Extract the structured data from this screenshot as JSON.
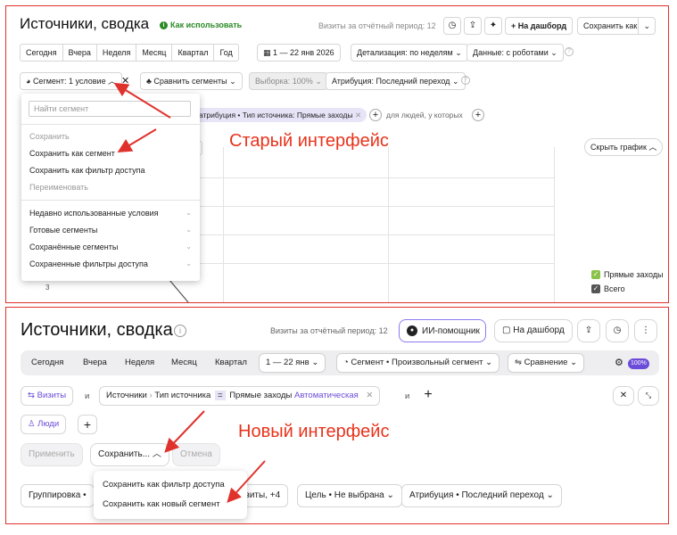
{
  "old_ui": {
    "title": "Источники, сводка",
    "help_link": "Как использовать",
    "visits": "Визиты за отчётный период: 12",
    "dashboard_button": "На дашборд",
    "save_as_button": "Сохранить как",
    "periods": [
      "Сегодня",
      "Вчера",
      "Неделя",
      "Месяц",
      "Квартал",
      "Год"
    ],
    "date_range": "1 — 22 янв 2026",
    "detail_select": "Детализация: по неделям",
    "data_select": "Данные: с роботами",
    "segment_button": "Сегмент: 1 условие",
    "compare_button": "Сравнить сегменты",
    "sample_button": "Выборка: 100%",
    "attribution_button": "Атрибуция: Последний переход",
    "chip_label": "атрибуция • Тип источника: Прямые заходы",
    "people_text": "для людей, у которых",
    "hide_chart_button": "Скрыть график",
    "dropdown": {
      "search_placeholder": "Найти сегмент",
      "save_label": "Сохранить",
      "save_as_segment": "Сохранить как сегмент",
      "save_as_filter": "Сохранить как фильтр доступа",
      "rename": "Переименовать",
      "groups": [
        "Недавно использованные условия",
        "Готовые сегменты",
        "Сохранённые сегменты",
        "Сохраненные фильтры доступа"
      ]
    },
    "y_tick": "3",
    "legend": [
      "Прямые заходы",
      "Всего"
    ],
    "annotation": "Старый интерфейс"
  },
  "new_ui": {
    "title": "Источники, сводка",
    "visits": "Визиты за отчётный период: 12",
    "ai_button": "ИИ-помощник",
    "dashboard_button": "На дашборд",
    "periods": [
      "Сегодня",
      "Вчера",
      "Неделя",
      "Месяц",
      "Квартал"
    ],
    "date_range": "1 — 22 янв",
    "segment_pill": "Сегмент • Произвольный сегмент",
    "compare_pill": "Сравнение",
    "badge": "100%",
    "visits_tag": "Визиты",
    "and1": "и",
    "filter_source": "Источники",
    "filter_type": "Тип источника",
    "filter_eq": "=",
    "filter_value": "Прямые заходы",
    "filter_mode": "Автоматическая",
    "and2": "и",
    "people_tag": "Люди",
    "apply_button": "Применить",
    "save_button": "Сохранить...",
    "cancel_button": "Отмена",
    "dropdown": {
      "save_as_filter": "Сохранить как фильтр доступа",
      "save_as_segment": "Сохранить как новый сегмент"
    },
    "group_button": "Группировка •",
    "visits_more": "Визиты, +4",
    "goal_button": "Цель • Не выбрана",
    "attribution_button": "Атрибуция • Последний переход",
    "annotation": "Новый интерфейс"
  },
  "colors": {
    "annotation_red": "#e8331c",
    "frame_red": "#e0322c",
    "accent_purple": "#6b4cd8",
    "help_green": "#2a8a25"
  }
}
